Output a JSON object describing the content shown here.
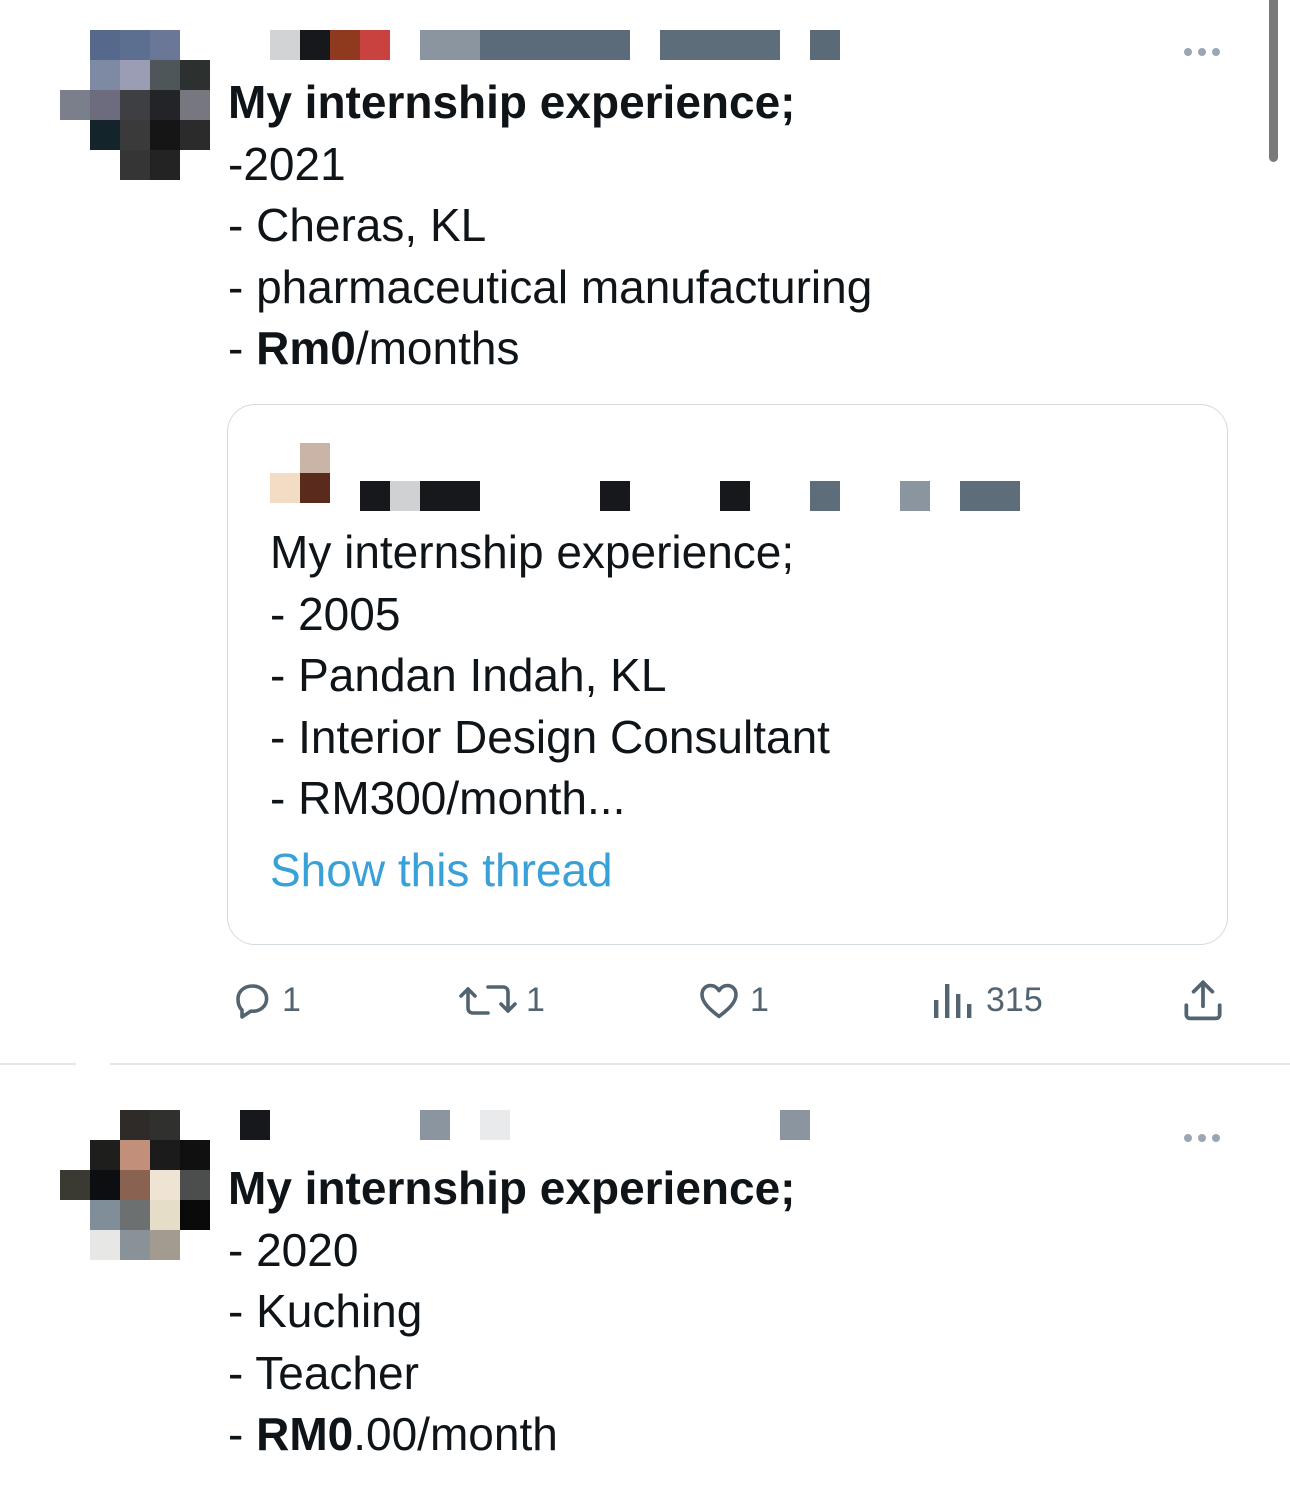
{
  "tweets": [
    {
      "more_label": "More options",
      "lines": [
        {
          "text": "My internship experience;",
          "bold": true
        },
        {
          "text": "-2021"
        },
        {
          "text": "- Cheras, KL"
        },
        {
          "text": "- pharmaceutical manufacturing"
        },
        {
          "prefix": "- ",
          "bold_part": "Rm0",
          "suffix": "/months"
        }
      ],
      "quoted": {
        "lines": [
          "My internship experience;",
          "- 2005",
          "- Pandan Indah, KL",
          "- Interior Design Consultant",
          "- RM300/month..."
        ],
        "show_thread": "Show this thread"
      },
      "actions": {
        "replies": "1",
        "retweets": "1",
        "likes": "1",
        "views": "315"
      }
    },
    {
      "lines": [
        {
          "text": "My internship experience;",
          "bold": true
        },
        {
          "text": "- 2020"
        },
        {
          "text": "- Kuching"
        },
        {
          "text": "- Teacher"
        },
        {
          "prefix": "- ",
          "bold_part": "RM0",
          "suffix": ".00/month"
        }
      ]
    }
  ],
  "icons": {
    "reply": "reply-icon",
    "retweet": "retweet-icon",
    "like": "heart-icon",
    "views": "views-icon",
    "share": "share-icon",
    "more": "more-icon"
  },
  "colors": {
    "link": "#3aa0d8",
    "action_gray": "#536471",
    "border": "#d4dbe0"
  }
}
